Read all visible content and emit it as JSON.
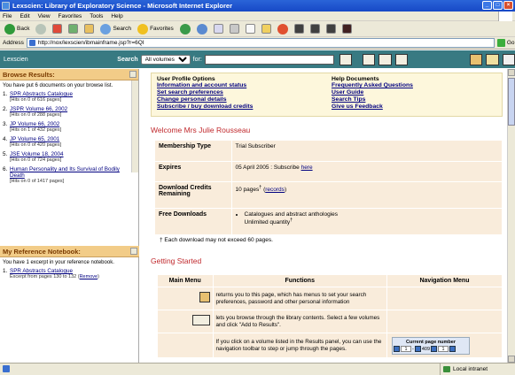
{
  "window": {
    "title": "Lexscien: Library of Exploratory Science - Microsoft Internet Explorer"
  },
  "menu": [
    "File",
    "Edit",
    "View",
    "Favorites",
    "Tools",
    "Help"
  ],
  "toolbar": {
    "back": "Back",
    "search": "Search",
    "favorites": "Favorites"
  },
  "address": {
    "label": "Address",
    "url": "http://nox/lexscien/ibmainframe.jsp?r=6QI",
    "go": "Go"
  },
  "app": {
    "brand": "Lexscien",
    "search_label": "Search",
    "scope": "All volumes",
    "for_label": "for:"
  },
  "browse": {
    "title": "Browse Results:",
    "summary": "You have put 6 documents on your browse list.",
    "items": [
      {
        "num": "1.",
        "title": "SPR Abstracts Catalogue",
        "hits": "[Hits on 0 of 616 pages]"
      },
      {
        "num": "2.",
        "title": "JSPR Volume 66, 2002",
        "hits": "[Hits on 0 of 288 pages]"
      },
      {
        "num": "3.",
        "title": "JP Volume 66, 2002",
        "hits": "[Hits on 1 of 432 pages]"
      },
      {
        "num": "4.",
        "title": "JP Volume 65, 2001",
        "hits": "[Hits on 0 of 420 pages]"
      },
      {
        "num": "5.",
        "title": "JSE Volume 18, 2004",
        "hits": "[Hits on 0 of 724 pages]"
      },
      {
        "num": "6.",
        "title": "Human Personality and Its Survival of Bodily Death",
        "hits": "[Hits on 0 of 1417 pages]"
      }
    ]
  },
  "notebook": {
    "title": "My Reference Notebook:",
    "summary": "You have 1 excerpt in your reference notebook.",
    "items": [
      {
        "num": "1.",
        "title": "SPR Abstracts Catalogue",
        "excerpt": "Excerpt from pages 130 to 132 (",
        "remove": "Remove",
        "close": ")"
      }
    ]
  },
  "profile": {
    "heading": "User Profile Options",
    "links": [
      "Information and account status",
      "Set search preferences",
      "Change personal details",
      "Subscribe / buy download credits"
    ]
  },
  "help": {
    "heading": "Help Documents",
    "links": [
      "Frequently Asked Questions",
      "User Guide",
      "Search Tips",
      "Give us Feedback"
    ]
  },
  "welcome": "Welcome Mrs Julie Rousseau",
  "membership": {
    "type_label": "Membership Type",
    "type_value": "Trial Subscriber",
    "expires_label": "Expires",
    "expires_value": "05 April 2005 : Subscribe ",
    "expires_link": "here",
    "credits_label": "Download Credits Remaining",
    "credits_value": "10 pages",
    "credits_sup": "†",
    "credits_link": "records",
    "free_label": "Free Downloads",
    "free_item": "Catalogues and abstract anthologies",
    "free_item2": "Unlimited quantity",
    "free_sup": "†"
  },
  "footnote": "† Each download may not exceed 60 pages.",
  "getting_started": {
    "title": "Getting Started",
    "headers": [
      "Main Menu",
      "Functions",
      "Navigation Menu"
    ],
    "rows": [
      {
        "text": "returns you to this page, which has menus to set your search preferences, password and other personal information"
      },
      {
        "text": "lets you browse through the library contents. Select a few volumes and click \"Add to Results\"."
      },
      {
        "text": "If you click on a volume listed in the Results panel, you can use the navigation toolbar to step or jump through the pages."
      }
    ],
    "pagenav": {
      "title": "Current page number",
      "page": "1",
      "dash": "-",
      "total": "409",
      "jump": "1"
    }
  },
  "status": {
    "zone": "Local intranet"
  },
  "colors": {
    "header_teal": "#387a82",
    "panel_orange": "#f2cc88",
    "accent_red": "#c0282c",
    "link_blue": "#000080"
  }
}
